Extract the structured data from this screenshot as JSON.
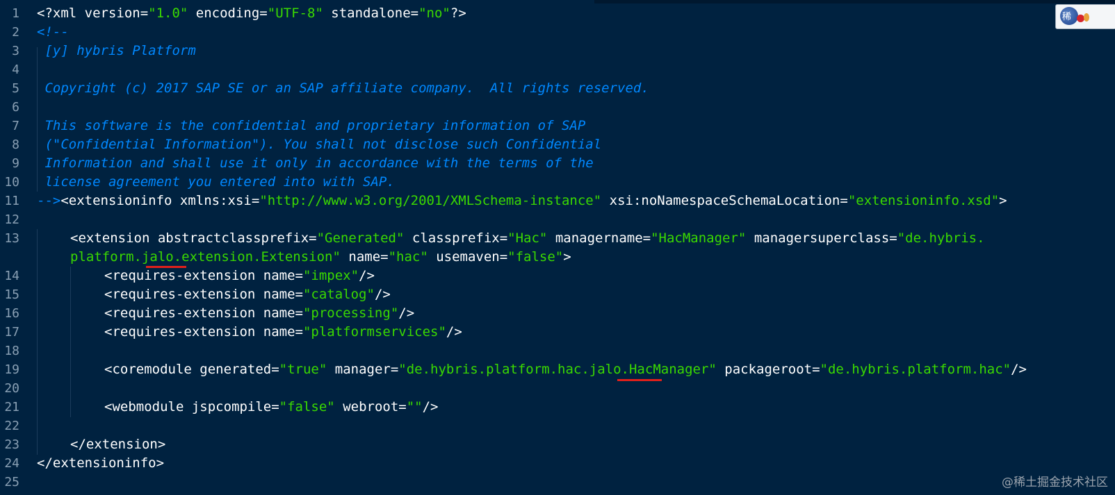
{
  "window": {
    "logo_glyph": "稀",
    "watermark": "@稀土掘金技术社区"
  },
  "colors": {
    "background": "#002240",
    "comment": "#0088ff",
    "string": "#3ad900",
    "tag": "#ffffff",
    "line_number": "#8aa0b4",
    "underline_mark": "#e0201b"
  },
  "gutter": {
    "line_numbers": [
      "1",
      "2",
      "3",
      "4",
      "5",
      "6",
      "7",
      "8",
      "9",
      "10",
      "11",
      "12",
      "13",
      "14",
      "15",
      "16",
      "17",
      "18",
      "19",
      "20",
      "21",
      "22",
      "23",
      "24",
      "25"
    ]
  },
  "code": {
    "l1": {
      "a": "<?xml version=",
      "b": "\"1.0\"",
      "c": " encoding=",
      "d": "\"UTF-8\"",
      "e": " standalone=",
      "f": "\"no\"",
      "g": "?>"
    },
    "l2": "<!--",
    "l3": " [y] hybris Platform",
    "l5": " Copyright (c) 2017 SAP SE or an SAP affiliate company.  All rights reserved.",
    "l7": " This software is the confidential and proprietary information of SAP",
    "l8": " (\"Confidential Information\"). You shall not disclose such Confidential",
    "l9": " Information and shall use it only in accordance with the terms of the",
    "l10": " license agreement you entered into with SAP.",
    "l11": {
      "a": "-->",
      "b": "<extensioninfo xmlns:xsi=",
      "c": "\"http://www.w3.org/2001/XMLSchema-instance\"",
      "d": " xsi:noNamespaceSchemaLocation=",
      "e": "\"extensioninfo.xsd\"",
      "f": ">"
    },
    "l13": {
      "a": "<extension abstractclassprefix=",
      "b": "\"Generated\"",
      "c": " classprefix=",
      "d": "\"Hac\"",
      "e": " managername=",
      "f": "\"HacManager\"",
      "g": " managersuperclass=",
      "h": "\"de.hybris."
    },
    "l13w": {
      "a": "platform.jalo.extension.Extension\"",
      "b": " name=",
      "c": "\"hac\"",
      "d": " usemaven=",
      "e": "\"false\"",
      "f": ">"
    },
    "l14": {
      "a": "<requires-extension name=",
      "b": "\"impex\"",
      "c": "/>"
    },
    "l15": {
      "a": "<requires-extension name=",
      "b": "\"catalog\"",
      "c": "/>"
    },
    "l16": {
      "a": "<requires-extension name=",
      "b": "\"processing\"",
      "c": "/>"
    },
    "l17": {
      "a": "<requires-extension name=",
      "b": "\"platformservices\"",
      "c": "/>"
    },
    "l19": {
      "a": "<coremodule generated=",
      "b": "\"true\"",
      "c": " manager=",
      "d": "\"de.hybris.platform.hac.jalo.HacManager\"",
      "e": " packageroot=",
      "f": "\"de.hybris.platform.hac\"",
      "g": "/>"
    },
    "l21": {
      "a": "<webmodule jspcompile=",
      "b": "\"false\"",
      "c": " webroot=",
      "d": "\"\"",
      "e": "/>"
    },
    "l23": "</extension>",
    "l24": "</extensioninfo>"
  }
}
